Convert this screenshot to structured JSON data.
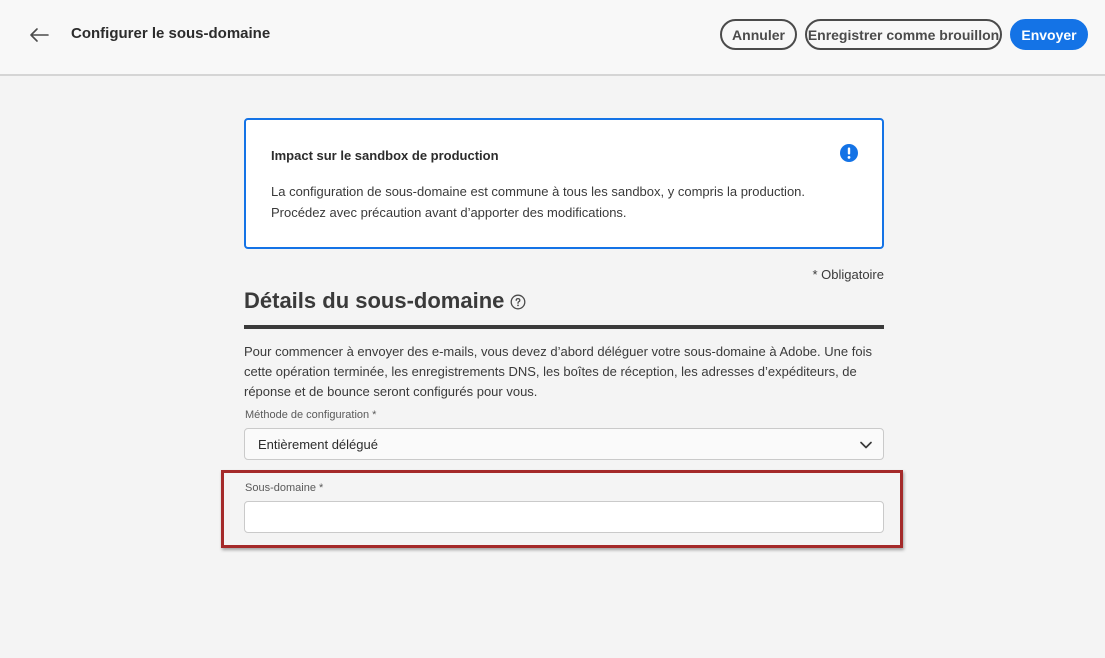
{
  "header": {
    "title": "Configurer le sous-domaine",
    "cancel_label": "Annuler",
    "draft_label": "Enregistrer comme brouillon",
    "send_label": "Envoyer"
  },
  "alert": {
    "title": "Impact sur le sandbox de production",
    "body": "La configuration de sous-domaine est commune à tous les sandbox, y compris la production. Procédez avec précaution avant d’apporter des modifications.",
    "icon": "alert-icon"
  },
  "form": {
    "required_note": "* Obligatoire",
    "section_title": "Détails du sous-domaine",
    "description": "Pour commencer à envoyer des e-mails, vous devez d’abord déléguer votre sous-domaine à Adobe. Une fois cette opération terminée, les enregistrements DNS, les boîtes de réception, les adresses d’expéditeurs, de réponse et de bounce seront configurés pour vous.",
    "method_label": "Méthode de configuration",
    "method_value": "Entièrement délégué",
    "subdomain_label": "Sous-domaine",
    "subdomain_value": "",
    "required_marker": "*"
  },
  "colors": {
    "accent": "#1473e6",
    "highlight": "#a42a2a",
    "background": "#f4f4f4"
  }
}
